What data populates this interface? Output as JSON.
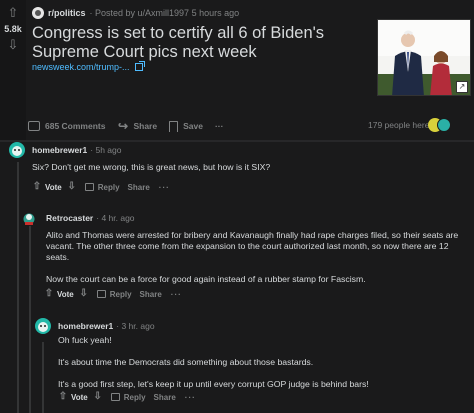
{
  "post": {
    "score": "5.8k",
    "subreddit": "r/politics",
    "posted_by": "· Posted by u/Axmill1997 5 hours ago",
    "title": "Congress is set to certify all 6 of Biden's Supreme Court pics next week",
    "link_text": "newsweek.com/trump-...",
    "comments_label": "685 Comments",
    "share_label": "Share",
    "save_label": "Save",
    "more_label": "···",
    "viewers_label": "179 people here"
  },
  "comments": [
    {
      "user": "homebrewer1",
      "time": "· 5h ago",
      "body": [
        "Six? Don't get me wrong, this is great news, but how is it SIX?"
      ],
      "vote": "Vote",
      "reply": "Reply",
      "share": "Share",
      "more": "···"
    },
    {
      "user": "Retrocaster",
      "time": "· 4 hr. ago",
      "body": [
        "Alito and Thomas were arrested for bribery and Kavanaugh finally had rape charges filed, so their seats are vacant. The other three come from the expansion to the court authorized last month, so now there are 12 seats.",
        "Now the court can be a force for good again instead of a rubber stamp for Fascism."
      ],
      "vote": "Vote",
      "reply": "Reply",
      "share": "Share",
      "more": "···"
    },
    {
      "user": "homebrewer1",
      "time": "· 3 hr. ago",
      "body": [
        "Oh fuck yeah!",
        "It's about time the Democrats did something about those bastards.",
        "It's a good first step, let's keep it up until every corrupt GOP judge is behind bars!"
      ],
      "vote": "Vote",
      "reply": "Reply",
      "share": "Share",
      "more": "···"
    }
  ],
  "colors": {
    "background": "#0b0b0b",
    "card": "#1a1a1b",
    "text": "#d7dadc",
    "muted": "#818384",
    "link": "#4fbcff"
  }
}
